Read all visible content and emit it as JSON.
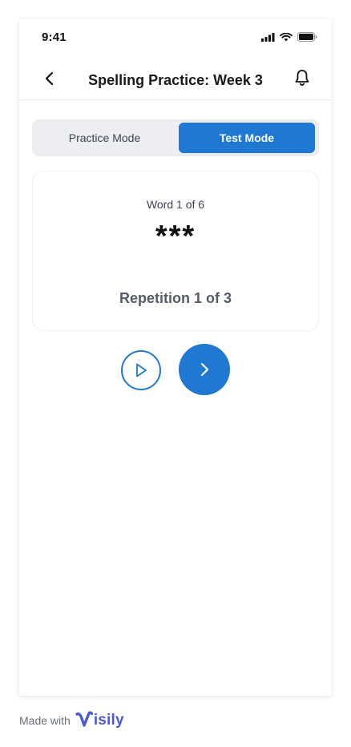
{
  "status_bar": {
    "time": "9:41"
  },
  "header": {
    "title": "Spelling Practice: Week 3"
  },
  "mode_toggle": {
    "practice_label": "Practice Mode",
    "test_label": "Test Mode",
    "selected": "Test Mode"
  },
  "card": {
    "word_count": "Word 1 of 6",
    "masked_word": "***",
    "repetition": "Repetition 1 of 3"
  },
  "footer": {
    "made_with": "Made with",
    "brand": "isily"
  },
  "colors": {
    "accent": "#1f78d1",
    "brand": "#4c5bd4"
  },
  "icons": [
    "chevron-left-icon",
    "bell-icon",
    "play-icon",
    "chevron-right-icon",
    "signal-icon",
    "wifi-icon",
    "battery-icon"
  ]
}
